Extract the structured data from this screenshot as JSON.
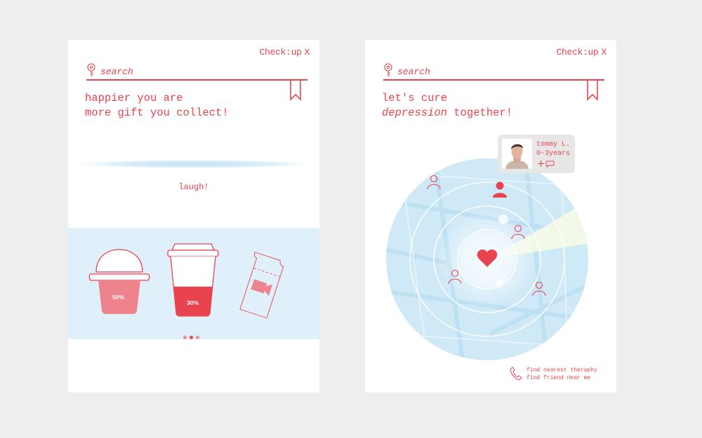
{
  "screens": [
    {
      "brand": "Check:up",
      "close": "X",
      "search_placeholder": "search",
      "headline_line1": "happier you are",
      "headline_line2": "more gift you collect!",
      "mood_label": "laugh!",
      "gifts": [
        {
          "icon": "ice-cream-cup-icon",
          "percent_label": "50%",
          "fill": 0.5
        },
        {
          "icon": "drink-cup-icon",
          "percent_label": "30%",
          "fill": 0.3
        },
        {
          "icon": "movie-ticket-icon"
        }
      ],
      "pager": {
        "pages": 3,
        "active": 2
      }
    },
    {
      "brand": "Check:up",
      "close": "X",
      "search_placeholder": "search",
      "headline_line1": "let's cure",
      "headline_line2_em": "depression",
      "headline_line2_rest": " together!",
      "profile": {
        "name": "tommy L.",
        "years": "0-3years",
        "add_icon": "plus-icon",
        "message_icon": "chat-bubble-icon"
      },
      "find_links": [
        "find nearest theraphy",
        "find friend near me"
      ],
      "find_icon": "phone-icon"
    }
  ],
  "colors": {
    "accent": "#e8434f",
    "panel": "#dff0fa",
    "card": "#ffffff",
    "background": "#efeeef",
    "map": "#cfe9f7"
  }
}
